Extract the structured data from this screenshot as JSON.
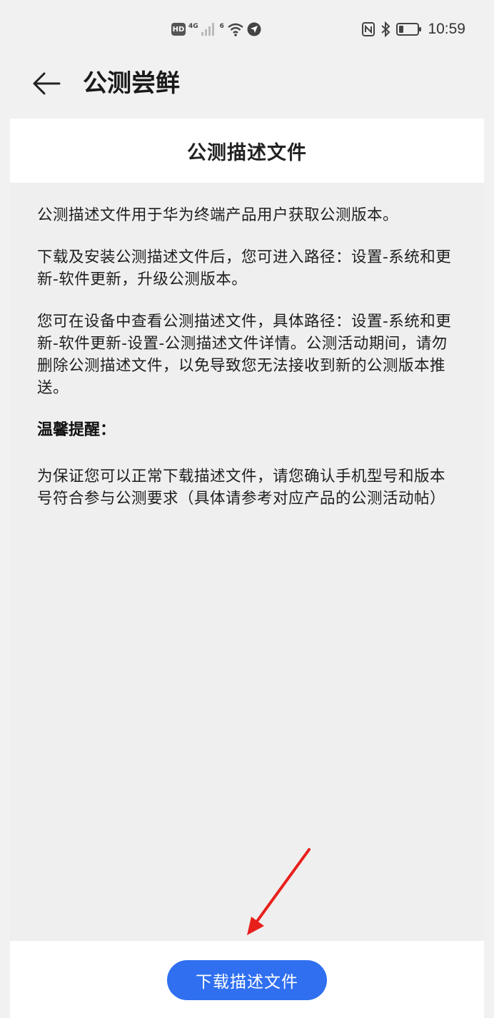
{
  "status_bar": {
    "hd": "HD",
    "network": "4G",
    "wifi_label": "6",
    "time": "10:59"
  },
  "app_bar": {
    "title": "公测尝鲜"
  },
  "card": {
    "title": "公测描述文件",
    "paragraphs": [
      "公测描述文件用于华为终端产品用户获取公测版本。",
      "下载及安装公测描述文件后，您可进入路径：设置-系统和更新-软件更新，升级公测版本。",
      "您可在设备中查看公测描述文件，具体路径：设置-系统和更新-软件更新-设置-公测描述文件详情。公测活动期间，请勿删除公测描述文件，以免导致您无法接收到新的公测版本推送。"
    ],
    "reminder_heading": "温馨提醒：",
    "reminder_text": "为保证您可以正常下载描述文件，请您确认手机型号和版本号符合参与公测要求（具体请参考对应产品的公测活动帖）"
  },
  "bottom": {
    "download_label": "下载描述文件"
  },
  "colors": {
    "accent": "#2f6ff0",
    "annotation_arrow": "#e8201c"
  }
}
